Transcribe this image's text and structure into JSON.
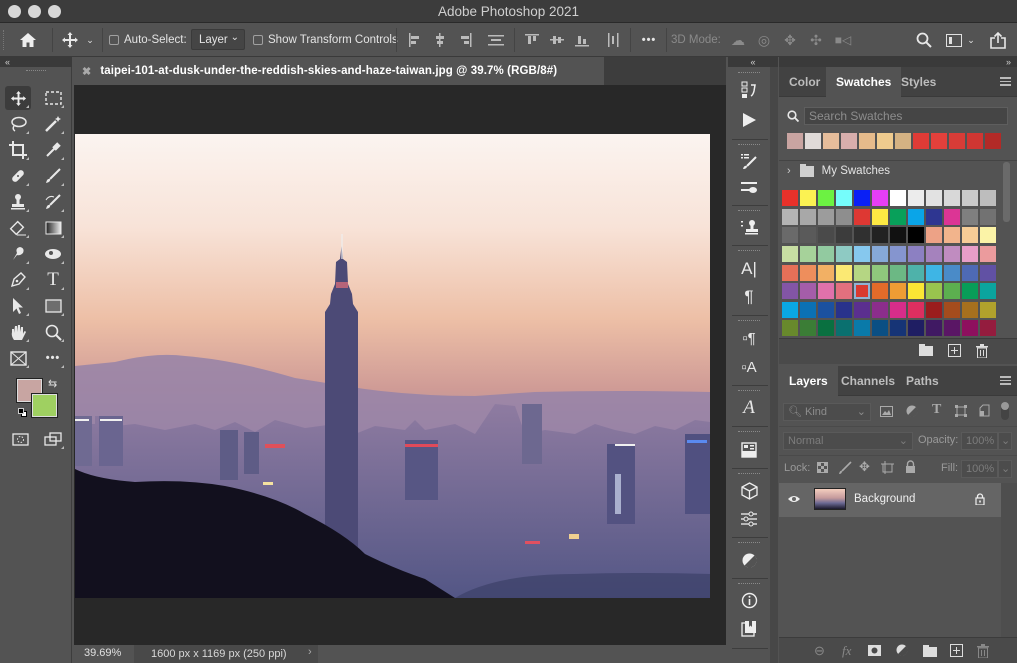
{
  "window": {
    "title": "Adobe Photoshop 2021"
  },
  "options_bar": {
    "auto_select_label": "Auto-Select:",
    "auto_select_checked": false,
    "auto_select_target": "Layer",
    "show_transform_label": "Show Transform Controls",
    "show_transform_checked": false,
    "three_d_mode_label": "3D Mode:",
    "more_label": "•••"
  },
  "document": {
    "tab_title": "taipei-101-at-dusk-under-the-reddish-skies-and-haze-taiwan.jpg @ 39.7% (RGB/8#)",
    "image_alt": "Taipei 101 at dusk under reddish skies and haze"
  },
  "status_bar": {
    "zoom": "39.69%",
    "doc_info": "1600 px x 1169 px (250 ppi)"
  },
  "tools": {
    "foreground_color": "#c8a5a2",
    "background_color": "#9fd061",
    "items": [
      "move",
      "rectangular-marquee",
      "lasso",
      "magic-wand",
      "crop",
      "eyedropper",
      "spot-healing-brush",
      "brush",
      "clone-stamp",
      "history-brush",
      "eraser",
      "gradient",
      "smudge",
      "dodge",
      "pen",
      "type",
      "path-selection",
      "rectangle",
      "hand",
      "zoom",
      "frame",
      "more-tools"
    ]
  },
  "swatches_panel": {
    "tabs": [
      "Color",
      "Swatches",
      "Styles"
    ],
    "active_tab": "Swatches",
    "search_placeholder": "Search Swatches",
    "recent": [
      "#c9a4a1",
      "#e0dad8",
      "#e6bd9b",
      "#d8aeac",
      "#e6bb8b",
      "#efcb8e",
      "#d4b283",
      "#df3b36",
      "#e2403b",
      "#d83c37",
      "#d03632",
      "#b22a27"
    ],
    "group_name": "My Swatches",
    "grid": [
      "#e8312a",
      "#fbf252",
      "#6cf242",
      "#75fdfb",
      "#0a20f5",
      "#e63ef5",
      "#ffffff",
      "#ececec",
      "#e2e2e2",
      "#d8d8d8",
      "#cacaca",
      "#bdbdbd",
      "#b4b4b4",
      "#a8a8a8",
      "#9c9c9c",
      "#8e8e8e",
      "#de3833",
      "#fde943",
      "#08a05a",
      "#0aa5e8",
      "#2e3691",
      "#dc3595",
      "#7f7f7f",
      "#727272",
      "#6a6a6a",
      "#5a5a5a",
      "#4a4a4a",
      "#3c3c3c",
      "#303030",
      "#222222",
      "#111111",
      "#000000",
      "#eda286",
      "#f2b48c",
      "#f6cc96",
      "#fbf3a7",
      "#c8dea2",
      "#a6d29a",
      "#92caa0",
      "#8ecac3",
      "#86c8ee",
      "#86a9d8",
      "#8595cf",
      "#8c80c2",
      "#a582bd",
      "#c08cc0",
      "#e89ec8",
      "#eb9b9d",
      "#e67058",
      "#ee8e5c",
      "#f2b064",
      "#fbe973",
      "#b5d683",
      "#8fc77c",
      "#6cb884",
      "#4eb2aa",
      "#3eb5e5",
      "#4a8bc8",
      "#4e6ab5",
      "#6151a4",
      "#8355a6",
      "#a45da9",
      "#e071ab",
      "#e3707e",
      "#d83a30",
      "#e36b2a",
      "#ee9c34",
      "#fae634",
      "#99c44e",
      "#5caf4f",
      "#089d58",
      "#0ba49e",
      "#09a8e4",
      "#0b71b5",
      "#1b51a0",
      "#29328c",
      "#5b2f8f",
      "#8c2d8c",
      "#d72d8a",
      "#dd2f60",
      "#9b1d1d",
      "#a44c1d",
      "#a6701e",
      "#b0a12c",
      "#68892c",
      "#3b7d36",
      "#097040",
      "#0a706f",
      "#0a7aa9",
      "#0a4f84",
      "#163476",
      "#1f1e63",
      "#401963",
      "#5a1665",
      "#8e105e",
      "#941c3e"
    ],
    "selected_index": 64
  },
  "layers_panel": {
    "tabs": [
      "Layers",
      "Channels",
      "Paths"
    ],
    "active_tab": "Layers",
    "filter_label": "Kind",
    "blend_mode": "Normal",
    "opacity_label": "Opacity:",
    "opacity_value": "100%",
    "lock_label": "Lock:",
    "fill_label": "Fill:",
    "fill_value": "100%",
    "layers": [
      {
        "name": "Background",
        "visible": true,
        "locked": true
      }
    ]
  }
}
